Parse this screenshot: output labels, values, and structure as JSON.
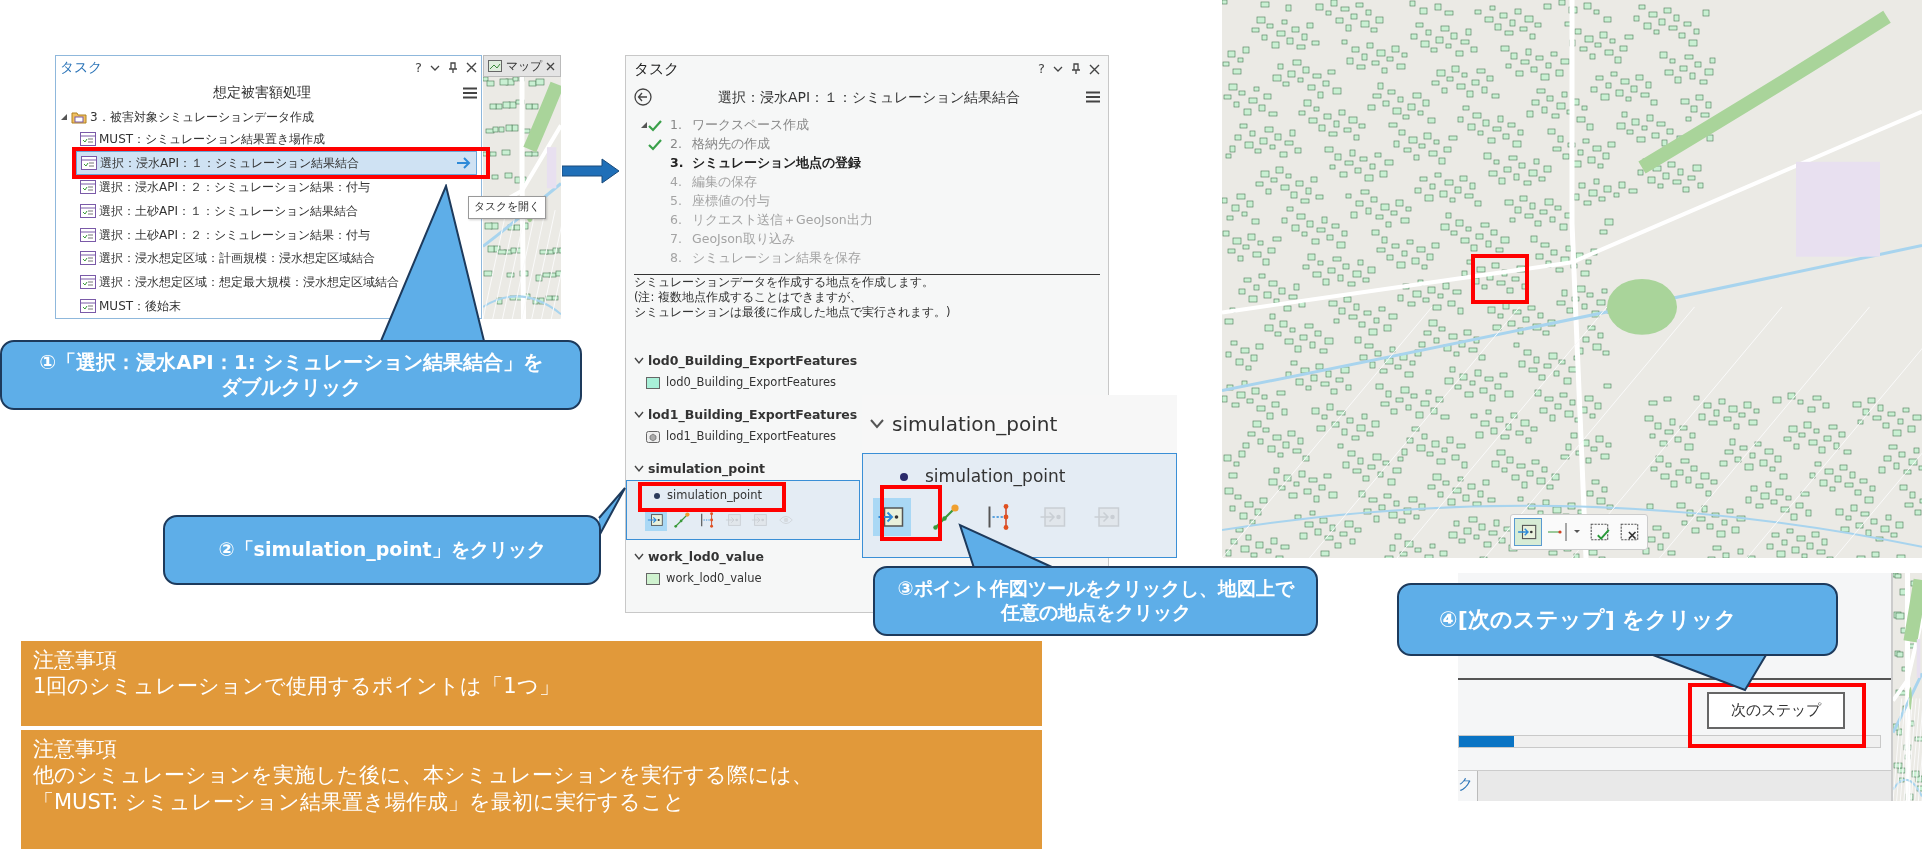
{
  "task_list_panel": {
    "title": "タスク",
    "help": "?",
    "heading": "想定被害額処理",
    "group": {
      "label": "3．被害対象シミュレーションデータ作成",
      "expanded": true,
      "children": [
        {
          "label": "MUST：シミュレーション結果置き場作成",
          "selected": false
        },
        {
          "label": "選択：浸水API：１：シミュレーション結果結合",
          "selected": true
        },
        {
          "label": "選択：浸水API：２：シミュレーション結果：付与",
          "selected": false
        },
        {
          "label": "選択：土砂API：１：シミュレーション結果結合",
          "selected": false
        },
        {
          "label": "選択：土砂API：２：シミュレーション結果：付与",
          "selected": false
        },
        {
          "label": "選択：浸水想定区域：計画規模：浸水想定区域結合",
          "selected": false
        },
        {
          "label": "選択：浸水想定区域：想定最大規模：浸水想定区域結合",
          "selected": false
        },
        {
          "label": "MUST：後始末",
          "selected": false
        }
      ]
    },
    "tooltip": "タスクを開く"
  },
  "map_tab": {
    "label": "マップ"
  },
  "task_detail_panel": {
    "title": "タスク",
    "help": "?",
    "heading": "選択：浸水API：１：シミュレーション結果結合",
    "steps": [
      {
        "number": "1.",
        "label": "ワークスペース作成",
        "completed": true,
        "current": false
      },
      {
        "number": "2.",
        "label": "格納先の作成",
        "completed": true,
        "current": false
      },
      {
        "number": "3.",
        "label": "シミュレーション地点の登録",
        "completed": false,
        "current": true
      },
      {
        "number": "4.",
        "label": "編集の保存",
        "completed": false,
        "current": false
      },
      {
        "number": "5.",
        "label": "座標値の付与",
        "completed": false,
        "current": false
      },
      {
        "number": "6.",
        "label": "リクエスト送信＋GeoJson出力",
        "completed": false,
        "current": false
      },
      {
        "number": "7.",
        "label": "GeoJson取り込み",
        "completed": false,
        "current": false
      },
      {
        "number": "8.",
        "label": "シミュレーション結果を保存",
        "completed": false,
        "current": false
      }
    ],
    "description": [
      "シミュレーションデータを作成する地点を作成します。",
      "(注: 複数地点作成することはできますが、",
      "シミュレーションは最後に作成した地点で実行されます。)"
    ],
    "layers": [
      {
        "name": "lod0_Building_ExportFeatures",
        "expanded": true,
        "items": [
          {
            "name": "lod0_Building_ExportFeatures",
            "kind": "polygon",
            "color": "#a8f0d8",
            "selected": false
          }
        ]
      },
      {
        "name": "lod1_Building_ExportFeatures",
        "expanded": true,
        "items": [
          {
            "name": "lod1_Building_ExportFeatures",
            "kind": "multipatch",
            "selected": false
          }
        ]
      },
      {
        "name": "simulation_point",
        "expanded": true,
        "items": [
          {
            "name": "simulation_point",
            "kind": "point",
            "selected": true,
            "tools": [
              {
                "kind": "point",
                "enabled": true,
                "selected": true
              },
              {
                "kind": "line",
                "enabled": true,
                "selected": false
              },
              {
                "kind": "vertices",
                "enabled": true,
                "selected": false
              },
              {
                "kind": "import",
                "enabled": false,
                "selected": false
              },
              {
                "kind": "import",
                "enabled": false,
                "selected": false
              },
              {
                "kind": "trace",
                "enabled": false,
                "selected": false
              }
            ]
          }
        ]
      },
      {
        "name": "work_lod0_value",
        "expanded": true,
        "items": [
          {
            "name": "work_lod0_value",
            "kind": "polygon",
            "color": "#cff2cf",
            "selected": false
          }
        ]
      }
    ]
  },
  "zoom_inset": {
    "layer": "simulation_point",
    "expanded": true,
    "item": "simulation_point",
    "selected": true,
    "tools": [
      {
        "kind": "point",
        "enabled": true,
        "selected": true
      },
      {
        "kind": "line",
        "enabled": true,
        "selected": false
      },
      {
        "kind": "vertices",
        "enabled": true,
        "selected": false
      },
      {
        "kind": "import",
        "enabled": false,
        "selected": false
      },
      {
        "kind": "import",
        "enabled": false,
        "selected": false
      }
    ]
  },
  "map_toolbar": {
    "tools": [
      {
        "kind": "point",
        "selected": true
      },
      {
        "kind": "line",
        "selected": false
      },
      {
        "kind": "finish",
        "selected": false
      },
      {
        "kind": "discard",
        "selected": false
      }
    ]
  },
  "next_step_panel": {
    "button": "次のステップ",
    "progress": {
      "level": 0.13
    },
    "tab": "ク"
  },
  "callouts": [
    {
      "text": "①「選択：浸水API：1: シミュレーション結果結合」をダブルクリック"
    },
    {
      "text": "②「simulation_point」をクリック"
    },
    {
      "text": "③ポイント作図ツールをクリックし、地図上で任意の地点をクリック"
    },
    {
      "text": "④[次のステップ] をクリック"
    }
  ],
  "notes": [
    {
      "title": "注意事項",
      "lines": [
        "1回のシミュレーションで使用するポイントは「1つ」"
      ]
    },
    {
      "title": "注意事項",
      "lines": [
        "他のシミュレーションを実施した後に、本シミュレーションを実行する際には、",
        "「MUST: シミュレーション結果置き場作成」を最初に実行すること"
      ]
    }
  ]
}
